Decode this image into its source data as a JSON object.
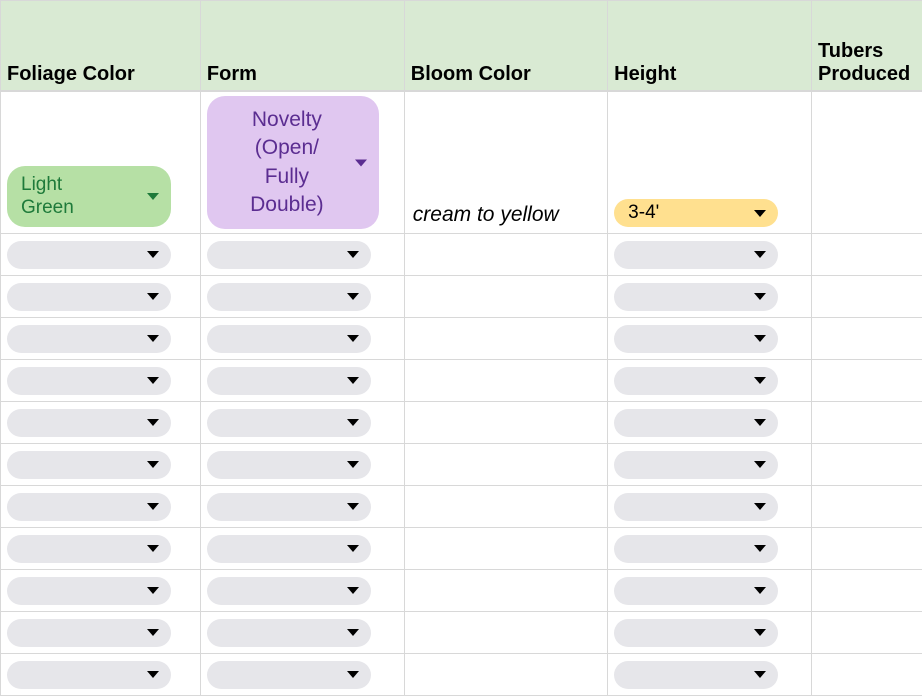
{
  "headers": {
    "foliage": "Foliage Color",
    "form": "Form",
    "bloom": "Bloom Color",
    "height": "Height",
    "tubers": "Tubers Produced"
  },
  "rows": [
    {
      "foliage": {
        "value": "Light\nGreen",
        "style": "green"
      },
      "form": {
        "value": "Novelty\n(Open/\nFully\nDouble)",
        "style": "purple"
      },
      "bloom": "cream to yellow",
      "height": {
        "value": "3-4'",
        "style": "yellow"
      }
    },
    {
      "foliage": {
        "value": "",
        "style": "empty"
      },
      "form": {
        "value": "",
        "style": "empty"
      },
      "bloom": "",
      "height": {
        "value": "",
        "style": "empty"
      }
    },
    {
      "foliage": {
        "value": "",
        "style": "empty"
      },
      "form": {
        "value": "",
        "style": "empty"
      },
      "bloom": "",
      "height": {
        "value": "",
        "style": "empty"
      }
    },
    {
      "foliage": {
        "value": "",
        "style": "empty"
      },
      "form": {
        "value": "",
        "style": "empty"
      },
      "bloom": "",
      "height": {
        "value": "",
        "style": "empty"
      }
    },
    {
      "foliage": {
        "value": "",
        "style": "empty"
      },
      "form": {
        "value": "",
        "style": "empty"
      },
      "bloom": "",
      "height": {
        "value": "",
        "style": "empty"
      }
    },
    {
      "foliage": {
        "value": "",
        "style": "empty"
      },
      "form": {
        "value": "",
        "style": "empty"
      },
      "bloom": "",
      "height": {
        "value": "",
        "style": "empty"
      }
    },
    {
      "foliage": {
        "value": "",
        "style": "empty"
      },
      "form": {
        "value": "",
        "style": "empty"
      },
      "bloom": "",
      "height": {
        "value": "",
        "style": "empty"
      }
    },
    {
      "foliage": {
        "value": "",
        "style": "empty"
      },
      "form": {
        "value": "",
        "style": "empty"
      },
      "bloom": "",
      "height": {
        "value": "",
        "style": "empty"
      }
    },
    {
      "foliage": {
        "value": "",
        "style": "empty"
      },
      "form": {
        "value": "",
        "style": "empty"
      },
      "bloom": "",
      "height": {
        "value": "",
        "style": "empty"
      }
    },
    {
      "foliage": {
        "value": "",
        "style": "empty"
      },
      "form": {
        "value": "",
        "style": "empty"
      },
      "bloom": "",
      "height": {
        "value": "",
        "style": "empty"
      }
    },
    {
      "foliage": {
        "value": "",
        "style": "empty"
      },
      "form": {
        "value": "",
        "style": "empty"
      },
      "bloom": "",
      "height": {
        "value": "",
        "style": "empty"
      }
    },
    {
      "foliage": {
        "value": "",
        "style": "empty"
      },
      "form": {
        "value": "",
        "style": "empty"
      },
      "bloom": "",
      "height": {
        "value": "",
        "style": "empty"
      }
    }
  ]
}
